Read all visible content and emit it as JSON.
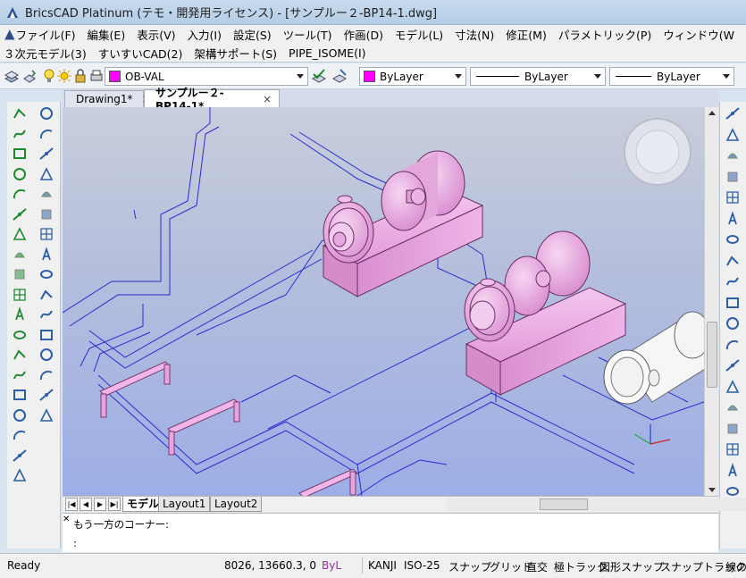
{
  "window": {
    "title": "BricsCAD Platinum (テモ・開発用ライセンス) - [サンプルー２-BP14-1.dwg]"
  },
  "menubar": {
    "row1": [
      "ファイル(F)",
      "編集(E)",
      "表示(V)",
      "入力(I)",
      "設定(S)",
      "ツール(T)",
      "作画(D)",
      "モデル(L)",
      "寸法(N)",
      "修正(M)",
      "パラメトリック(P)",
      "ウィンドウ(W"
    ],
    "row2": [
      "３次元モデル(3)",
      "すいすいCAD(2)",
      "架構サポート(S)",
      "PIPE_ISOME(I)"
    ]
  },
  "toolbar": {
    "layer": "OB-VAL",
    "color": "ByLayer",
    "linetype": "ByLayer",
    "lineweight": "ByLayer",
    "accent_color": "#ff00ff"
  },
  "tabs": [
    {
      "label": "Drawing1*",
      "close": "×"
    },
    {
      "label": "サンプルー２-BP14-1*",
      "close": "×"
    }
  ],
  "layout_tabs": [
    "モデル",
    "Layout1",
    "Layout2"
  ],
  "command": {
    "history": "もう一方のコーナー:",
    "prompt": ":"
  },
  "status": {
    "ready": "Ready",
    "coords": "8026, 13660.3, 0",
    "layer_state": "ByL",
    "items": [
      "KANJI",
      "ISO-25",
      "スナップ",
      "グリッド",
      "直交",
      "極トラック",
      "図形スナップ",
      "スナップトラック",
      "線の"
    ]
  },
  "icons": {
    "left_col1": [
      "polyline-icon",
      "spline-icon",
      "rectangle-icon",
      "rotate-arc-icon",
      "circle-icon",
      "arc-icon",
      "polyline-edit-icon",
      "ellipse-icon",
      "point-icon",
      "region-icon",
      "boundary-icon",
      "wipeout-icon",
      "cloud-icon",
      "hatch-icon",
      "table-icon",
      "text-icon",
      "mtext-icon",
      "block-icon",
      "insert-icon"
    ],
    "left_col2": [
      "regen-icon",
      "zoom-in-icon",
      "zoom-out-icon",
      "zoom-window-icon",
      "zoom-extents-icon",
      "pan-icon",
      "view-icon",
      "ucs-icon",
      "camera-icon",
      "perspective-icon",
      "iso-view-icon",
      "visual-style-icon",
      "viewport-icon",
      "paste-icon",
      "properties-icon",
      "layer-icon"
    ],
    "right": [
      "move-icon",
      "copy-icon",
      "mirror-icon",
      "brush-icon",
      "eyedropper-icon",
      "scale-icon",
      "rotate-icon",
      "circle-arrows-icon",
      "mirror-3d-icon",
      "array-icon",
      "3d-box-icon",
      "3d-solid-icon",
      "trim-icon",
      "extend-icon",
      "break-icon",
      "join-icon",
      "chamfer-icon",
      "fillet-icon",
      "explode-icon"
    ]
  }
}
